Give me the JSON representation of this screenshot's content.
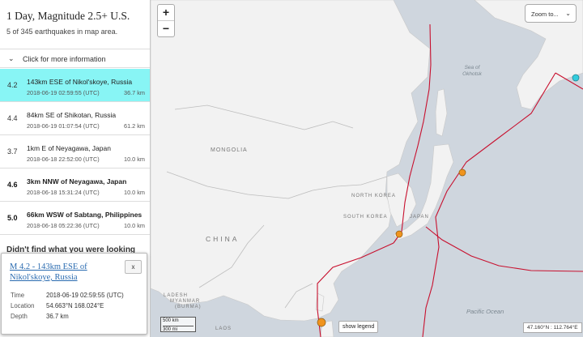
{
  "feed": {
    "title": "1 Day, Magnitude 2.5+ U.S.",
    "count": "5 of 345 earthquakes in map area."
  },
  "info_toggle": {
    "chevron": "⌄",
    "label": "Click for more information"
  },
  "earthquakes": [
    {
      "mag": "4.2",
      "place": "143km ESE of Nikol'skoye, Russia",
      "time": "2018-06-19 02:59:55 (UTC)",
      "depth": "36.7 km",
      "selected": true
    },
    {
      "mag": "4.4",
      "place": "84km SE of Shikotan, Russia",
      "time": "2018-06-19 01:07:54 (UTC)",
      "depth": "61.2 km"
    },
    {
      "mag": "3.7",
      "place": "1km E of Neyagawa, Japan",
      "time": "2018-06-18 22:52:00 (UTC)",
      "depth": "10.0 km"
    },
    {
      "mag": "4.6",
      "place": "3km NNW of Neyagawa, Japan",
      "time": "2018-06-18 15:31:24 (UTC)",
      "depth": "10.0 km"
    },
    {
      "mag": "5.0",
      "place": "66km WSW of Sabtang, Philippines",
      "time": "2018-06-18 05:22:36 (UTC)",
      "depth": "10.0 km"
    }
  ],
  "cut_text": "Didn't find what you were looking",
  "map": {
    "zoom_in": "+",
    "zoom_out": "−",
    "zoom_to": "Zoom to...",
    "zoom_caret": "⌄",
    "labels": {
      "mongolia": "MONGOLIA",
      "china": "CHINA",
      "north_korea": "NORTH KOREA",
      "south_korea": "SOUTH KOREA",
      "japan": "JAPAN",
      "myanmar": "MYANMAR",
      "burma": "(BURMA)",
      "laos": "LAOS",
      "bangladesh": "LADESH",
      "sea_of_okhotsk_1": "Sea of",
      "sea_of_okhotsk_2": "Okhotsk",
      "pacific": "Pacific Ocean"
    },
    "scale_km": "500 km",
    "scale_mi": "300 mi",
    "show_legend": "show legend",
    "coords": "47.160°N : 112.764°E"
  },
  "popup": {
    "title": "M 4.2 - 143km ESE of Nikol'skoye, Russia",
    "close": "x",
    "time_label": "Time",
    "time_value": "2018-06-19 02:59:55 (UTC)",
    "location_label": "Location",
    "location_value": "54.663°N 168.024°E",
    "depth_label": "Depth",
    "depth_value": "36.7 km"
  },
  "colors": {
    "selected": "#88f5f5",
    "land": "#f2f2f2",
    "water": "#cfd6de",
    "plate_boundary": "#c8102e",
    "quake_marker": "#f0941e",
    "selected_marker": "#33ccdd"
  }
}
